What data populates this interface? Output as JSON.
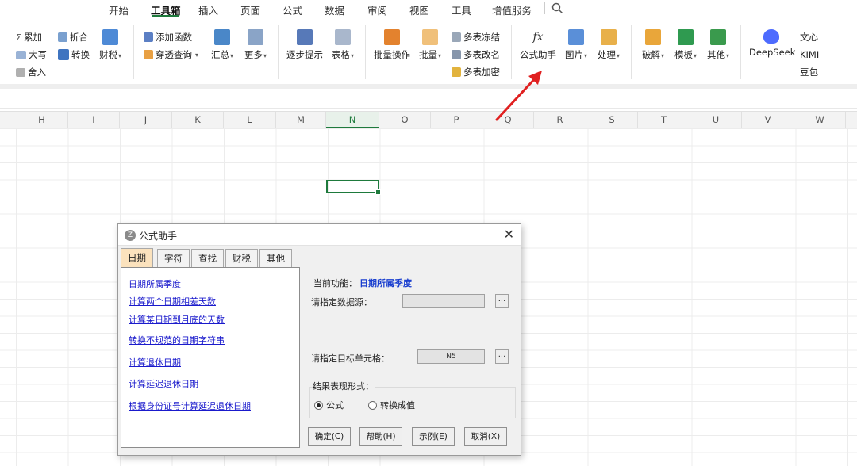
{
  "menu": {
    "tabs": [
      "开始",
      "工具箱",
      "插入",
      "页面",
      "公式",
      "数据",
      "审阅",
      "视图",
      "工具",
      "增值服务"
    ],
    "search_icon": "search-icon"
  },
  "ribbon": {
    "accumulate": "累加",
    "fold": "折合",
    "uppercase": "大写",
    "convert": "转换",
    "round": "舍入",
    "finance": "财税",
    "add_function": "添加函数",
    "cross_query": "穿透查询",
    "summary": "汇总",
    "more": "更多",
    "step_hint": "逐步提示",
    "table": "表格",
    "batch_op": "批量操作",
    "batch": "批量",
    "multi_freeze": "多表冻结",
    "multi_rename": "多表改名",
    "multi_encrypt": "多表加密",
    "formula_assistant": "公式助手",
    "image": "图片",
    "process": "处理",
    "crack": "破解",
    "template": "模板",
    "other": "其他",
    "deepseek": "DeepSeek",
    "wenxin": "文心",
    "kimi": "KIMI",
    "doubao": "豆包"
  },
  "sheet": {
    "columns": [
      "H",
      "I",
      "J",
      "K",
      "L",
      "M",
      "N",
      "O",
      "P",
      "Q",
      "R",
      "S",
      "T",
      "U",
      "V",
      "W"
    ],
    "selected_column": "N"
  },
  "dialog": {
    "title": "公式助手",
    "tabs": [
      "日期",
      "字符",
      "查找",
      "财税",
      "其他"
    ],
    "links": [
      "日期所属季度",
      "计算两个日期相差天数",
      "计算某日期到月底的天数",
      "转换不规范的日期字符串",
      "计算退休日期",
      "计算延迟退休日期",
      "根据身份证号计算延迟退休日期"
    ],
    "current_label": "当前功能：",
    "current_value": "日期所属季度",
    "source_label": "请指定数据源：",
    "source_value": "",
    "target_label": "请指定目标单元格：",
    "target_value": "N5",
    "dots": "...",
    "result_label": "结果表现形式：",
    "radio_formula": "公式",
    "radio_value": "转换成值",
    "buttons": [
      "确定(C)",
      "帮助(H)",
      "示例(E)",
      "取消(X)"
    ]
  },
  "colors": {
    "accent": "#1e7a3c",
    "link": "#1a1acc",
    "arrow": "#e02020",
    "active_tab": "#fbe2bd"
  }
}
